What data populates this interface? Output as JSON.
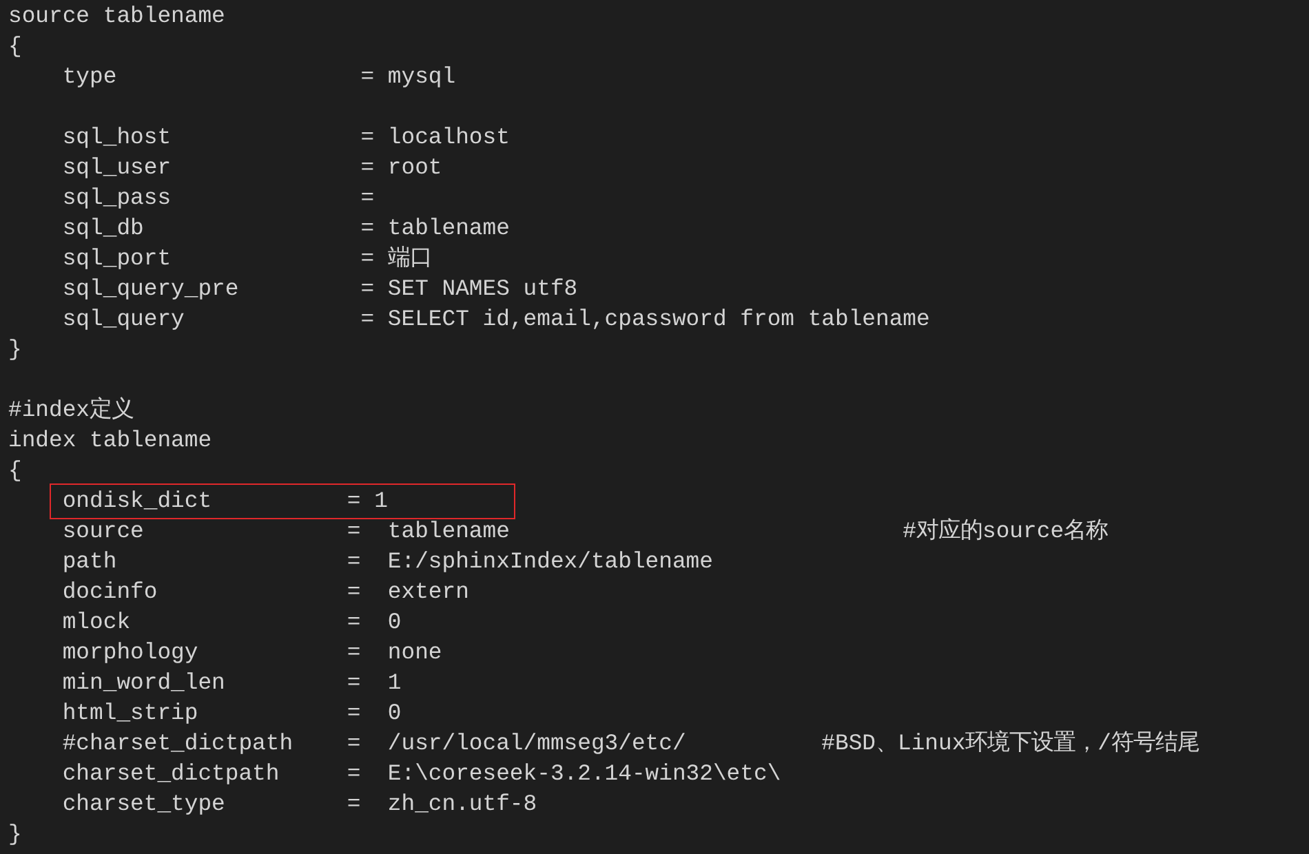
{
  "editor": {
    "lines": [
      {
        "kind": "code",
        "text": "source tablename",
        "highlighted": false
      },
      {
        "kind": "code",
        "text": "{",
        "highlighted": false
      },
      {
        "kind": "code",
        "text": "    type                  = mysql",
        "highlighted": false
      },
      {
        "kind": "blank"
      },
      {
        "kind": "code",
        "text": "    sql_host              = localhost",
        "highlighted": false
      },
      {
        "kind": "code",
        "text": "    sql_user              = root",
        "highlighted": false
      },
      {
        "kind": "code",
        "text": "    sql_pass              =",
        "highlighted": false
      },
      {
        "kind": "code",
        "text": "    sql_db                = tablename",
        "highlighted": false
      },
      {
        "kind": "code",
        "text": "    sql_port              = 端口",
        "highlighted": false
      },
      {
        "kind": "code",
        "text": "    sql_query_pre         = SET NAMES utf8",
        "highlighted": false
      },
      {
        "kind": "code",
        "text": "    sql_query             = SELECT id,email,cpassword from tablename",
        "highlighted": false
      },
      {
        "kind": "code",
        "text": "}",
        "highlighted": false
      },
      {
        "kind": "blank"
      },
      {
        "kind": "code",
        "text": "#index定义",
        "highlighted": false
      },
      {
        "kind": "code",
        "text": "index tablename",
        "highlighted": false
      },
      {
        "kind": "code",
        "text": "{",
        "highlighted": false
      },
      {
        "kind": "code",
        "text": "    ondisk_dict          = 1",
        "highlighted": true
      },
      {
        "kind": "code",
        "text": "    source               =  tablename                             #对应的source名称",
        "highlighted": false
      },
      {
        "kind": "code",
        "text": "    path                 =  E:/sphinxIndex/tablename",
        "highlighted": false
      },
      {
        "kind": "code",
        "text": "    docinfo              =  extern",
        "highlighted": false
      },
      {
        "kind": "code",
        "text": "    mlock                =  0",
        "highlighted": false
      },
      {
        "kind": "code",
        "text": "    morphology           =  none",
        "highlighted": false
      },
      {
        "kind": "code",
        "text": "    min_word_len         =  1",
        "highlighted": false
      },
      {
        "kind": "code",
        "text": "    html_strip           =  0",
        "highlighted": false
      },
      {
        "kind": "code",
        "text": "    #charset_dictpath    =  /usr/local/mmseg3/etc/          #BSD、Linux环境下设置，/符号结尾",
        "highlighted": false
      },
      {
        "kind": "code",
        "text": "    charset_dictpath     =  E:\\coreseek-3.2.14-win32\\etc\\",
        "highlighted": false
      },
      {
        "kind": "code",
        "text": "    charset_type         =  zh_cn.utf-8",
        "highlighted": false
      },
      {
        "kind": "code",
        "text": "}",
        "highlighted": false
      }
    ]
  }
}
